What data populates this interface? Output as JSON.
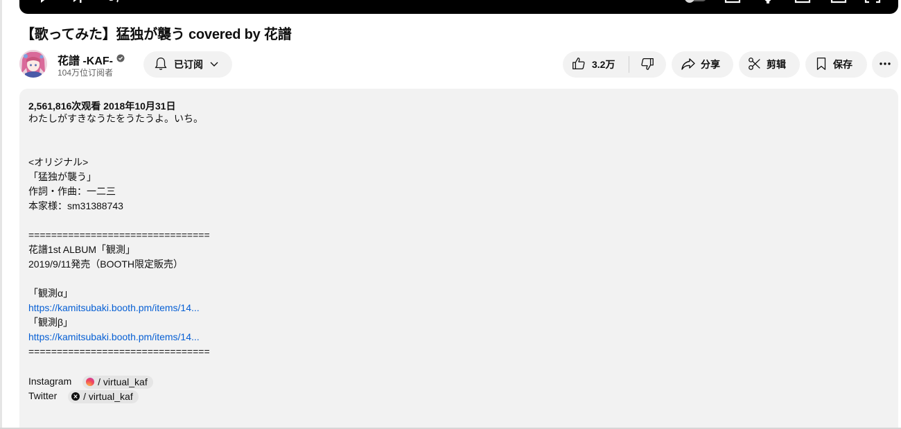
{
  "video": {
    "title": "【歌ってみた】猛独が襲う covered by 花譜"
  },
  "channel": {
    "name": "花譜 -KAF-",
    "subscribers": "104万位订阅者",
    "subscribe_label": "已订阅"
  },
  "actions": {
    "like_count": "3.2万",
    "share_label": "分享",
    "clip_label": "剪辑",
    "save_label": "保存"
  },
  "description": {
    "meta": "2,561,816次观看  2018年10月31日",
    "intro": "わたしがすきなうたをうたうよ。いち。",
    "original_header": "<オリジナル>",
    "original_song": "「猛独が襲う」",
    "credits": "作詞・作曲：一二三",
    "source": "本家様：sm31388743",
    "divider_top": "================================",
    "album_title": "花譜1st ALBUM「観測」",
    "album_release": "2019/9/11発売（BOOTH限定販売）",
    "alpha_label": "「観測α」",
    "alpha_link": "https://kamitsubaki.booth.pm/items/14...",
    "beta_label": "「観測β」",
    "beta_link": "https://kamitsubaki.booth.pm/items/14...",
    "divider_bottom": "================================",
    "instagram_label": "Instagram",
    "instagram_handle": "/ virtual_kaf",
    "twitter_label": "Twitter",
    "twitter_handle": "/ virtual_kaf"
  },
  "colors": {
    "link": "#065fd4",
    "pill_bg": "#f2f2f2",
    "player_bg": "#000000"
  },
  "icons": {
    "player": [
      "play-icon",
      "next-icon",
      "volume-icon",
      "autoplay-toggle-icon",
      "subtitles-icon",
      "settings-icon",
      "miniplayer-icon",
      "theater-icon",
      "fullscreen-icon"
    ],
    "channel": [
      "verified-icon"
    ],
    "actions": [
      "bell-icon",
      "chevron-down-icon",
      "thumbs-up-icon",
      "thumbs-down-icon",
      "share-arrow-icon",
      "scissors-icon",
      "bookmark-icon",
      "more-horizontal-icon"
    ],
    "social": [
      "instagram-icon",
      "x-icon"
    ]
  }
}
